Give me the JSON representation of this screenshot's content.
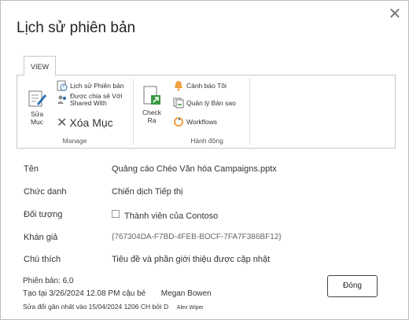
{
  "dialog": {
    "title": "Lịch sử phiên bản",
    "close_glyph": "✕"
  },
  "ribbon": {
    "tab_label": "VIEW",
    "groups": {
      "manage": {
        "label": "Manage",
        "edit_label_1": "Sửa",
        "edit_label_2": "Mục",
        "version_history": "Lịch sử Phiên bản",
        "shared_with_1": "Được chia sẻ Với",
        "shared_with_2": "Shared With",
        "delete_item": "Xóa Mục"
      },
      "check_out": {
        "label_1": "Check",
        "label_2": "Ra"
      },
      "actions": {
        "label": "Hành động",
        "alert_me": "Cảnh báo Tôi",
        "manage_copies": "Quản lý Bản sao",
        "workflows": "Workflows"
      }
    }
  },
  "properties": [
    {
      "label": "Tên",
      "value": "Quảng cáo Chéo Văn hóa Campaigns.pptx"
    },
    {
      "label": "Chức danh",
      "value": "Chiến dịch Tiếp thị"
    },
    {
      "label": "Đối tượng",
      "value": "Thành viên của Contoso"
    },
    {
      "label": "Khán giả",
      "value": "{767304DA-F7BD-4FEB-BOCF-7FA7F386BF12}"
    },
    {
      "label": "Chú thích",
      "value": "Tiêu đề và phần giới thiệu được cập nhật"
    }
  ],
  "footer": {
    "version": "Phiên bản: 6.0",
    "created": "Tạo tại 3/26/2024 12.08 PM cậu bé",
    "created_by": "Megan Bowen",
    "modified": "Sửa đổi gần nhất vào 15/04/2024 1206 CH bởi D",
    "modified_by": "Alex Wiper",
    "close_button": "Đóng"
  },
  "colors": {
    "accent_orange": "#f0a040",
    "accent_blue": "#2b6cb0",
    "accent_green": "#3a9a46"
  }
}
